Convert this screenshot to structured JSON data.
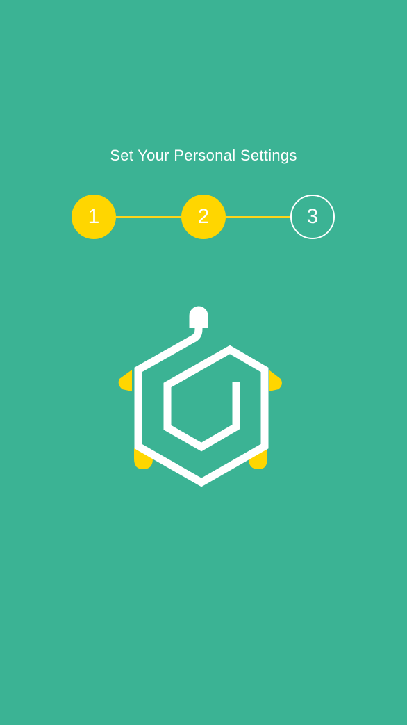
{
  "header": {
    "title": "Set Your Personal Settings"
  },
  "stepper": {
    "current_step": 3,
    "total_steps": 3,
    "steps": [
      {
        "label": "1",
        "state": "completed"
      },
      {
        "label": "2",
        "state": "completed"
      },
      {
        "label": "3",
        "state": "current"
      }
    ]
  },
  "logo": {
    "icon": "turtle-spiral-logo-icon"
  },
  "colors": {
    "background": "#3bb394",
    "accent": "#ffd600",
    "foreground": "#ffffff"
  }
}
